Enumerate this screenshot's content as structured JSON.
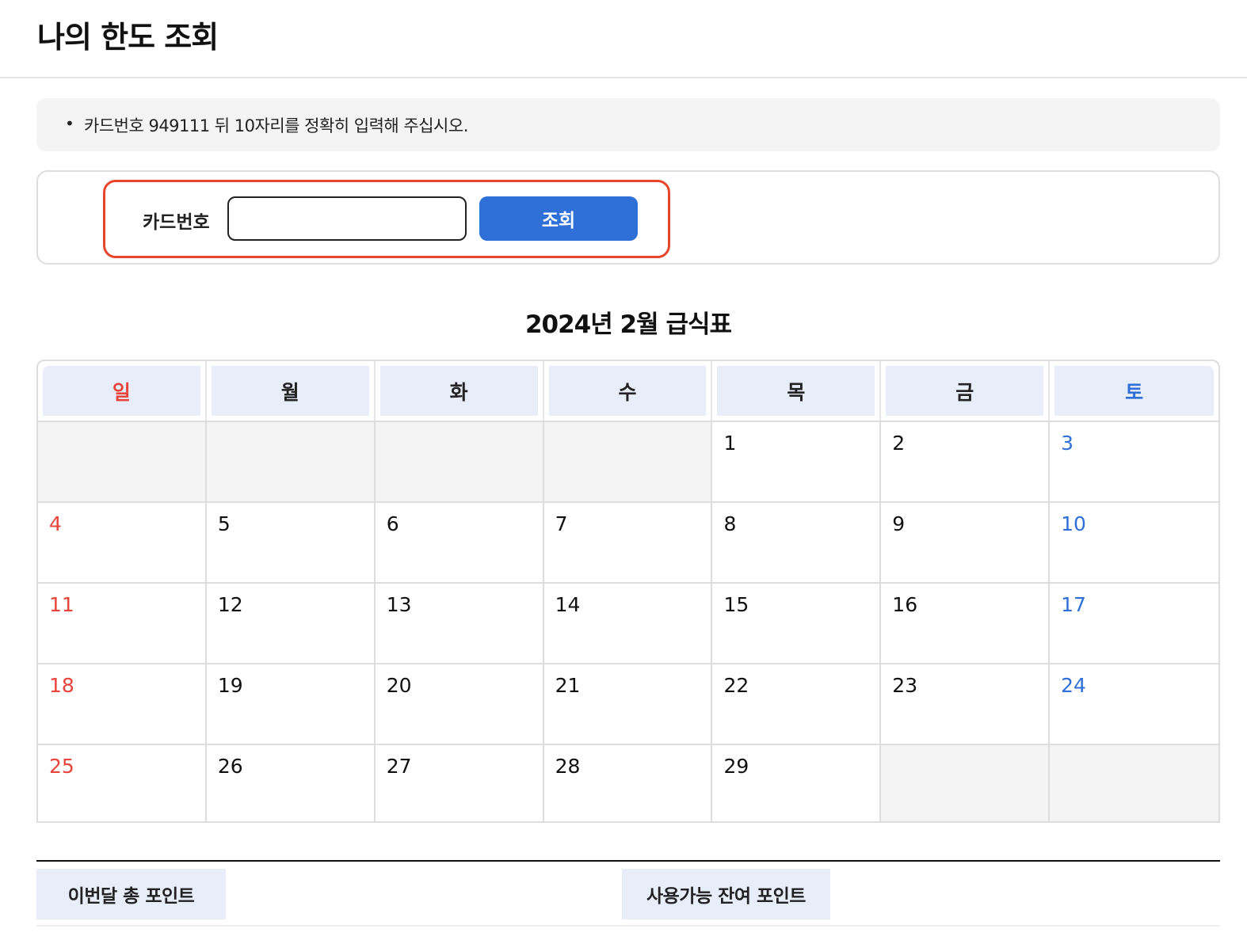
{
  "page": {
    "title": "나의 한도 조회"
  },
  "notice": {
    "bullet": "•",
    "text": "카드번호 949111 뒤 10자리를 정확히 입력해 주십시오."
  },
  "search": {
    "label": "카드번호",
    "value": "",
    "placeholder": "",
    "button_label": "조회"
  },
  "calendar": {
    "title": "2024년 2월 급식표",
    "weekdays": [
      "일",
      "월",
      "화",
      "수",
      "목",
      "금",
      "토"
    ],
    "weeks": [
      [
        "",
        "",
        "",
        "",
        "1",
        "2",
        "3"
      ],
      [
        "4",
        "5",
        "6",
        "7",
        "8",
        "9",
        "10"
      ],
      [
        "11",
        "12",
        "13",
        "14",
        "15",
        "16",
        "17"
      ],
      [
        "18",
        "19",
        "20",
        "21",
        "22",
        "23",
        "24"
      ],
      [
        "25",
        "26",
        "27",
        "28",
        "29",
        "",
        ""
      ]
    ]
  },
  "points": {
    "monthly_total_label": "이번달 총 포인트",
    "remaining_label": "사용가능 잔여 포인트"
  },
  "colors": {
    "accent": "#2f6fd8",
    "sunday": "#e8443a",
    "saturday": "#2f6fd8",
    "highlight": "#e8432b",
    "header_bg": "#e8eef9"
  }
}
